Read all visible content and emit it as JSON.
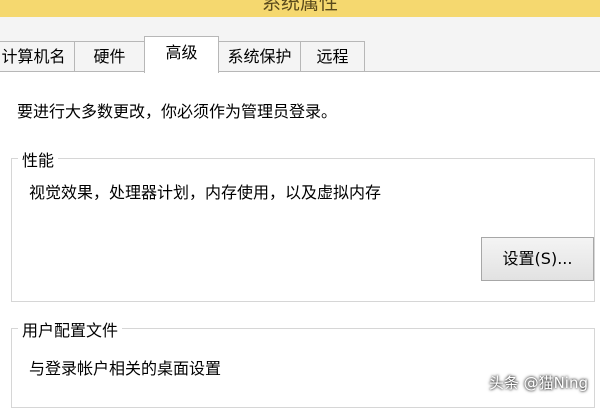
{
  "window": {
    "title": "系统属性"
  },
  "tabs": [
    {
      "label": "计算机名"
    },
    {
      "label": "硬件"
    },
    {
      "label": "高级"
    },
    {
      "label": "系统保护"
    },
    {
      "label": "远程"
    }
  ],
  "active_tab": "高级",
  "admin_note": "要进行大多数更改，你必须作为管理员登录。",
  "performance": {
    "label": "性能",
    "description": "视觉效果，处理器计划，内存使用，以及虚拟内存",
    "settings_button": "设置(S)..."
  },
  "user_profiles": {
    "label": "用户配置文件",
    "description": "与登录帐户相关的桌面设置"
  },
  "watermark": "头条 @猫Ning"
}
